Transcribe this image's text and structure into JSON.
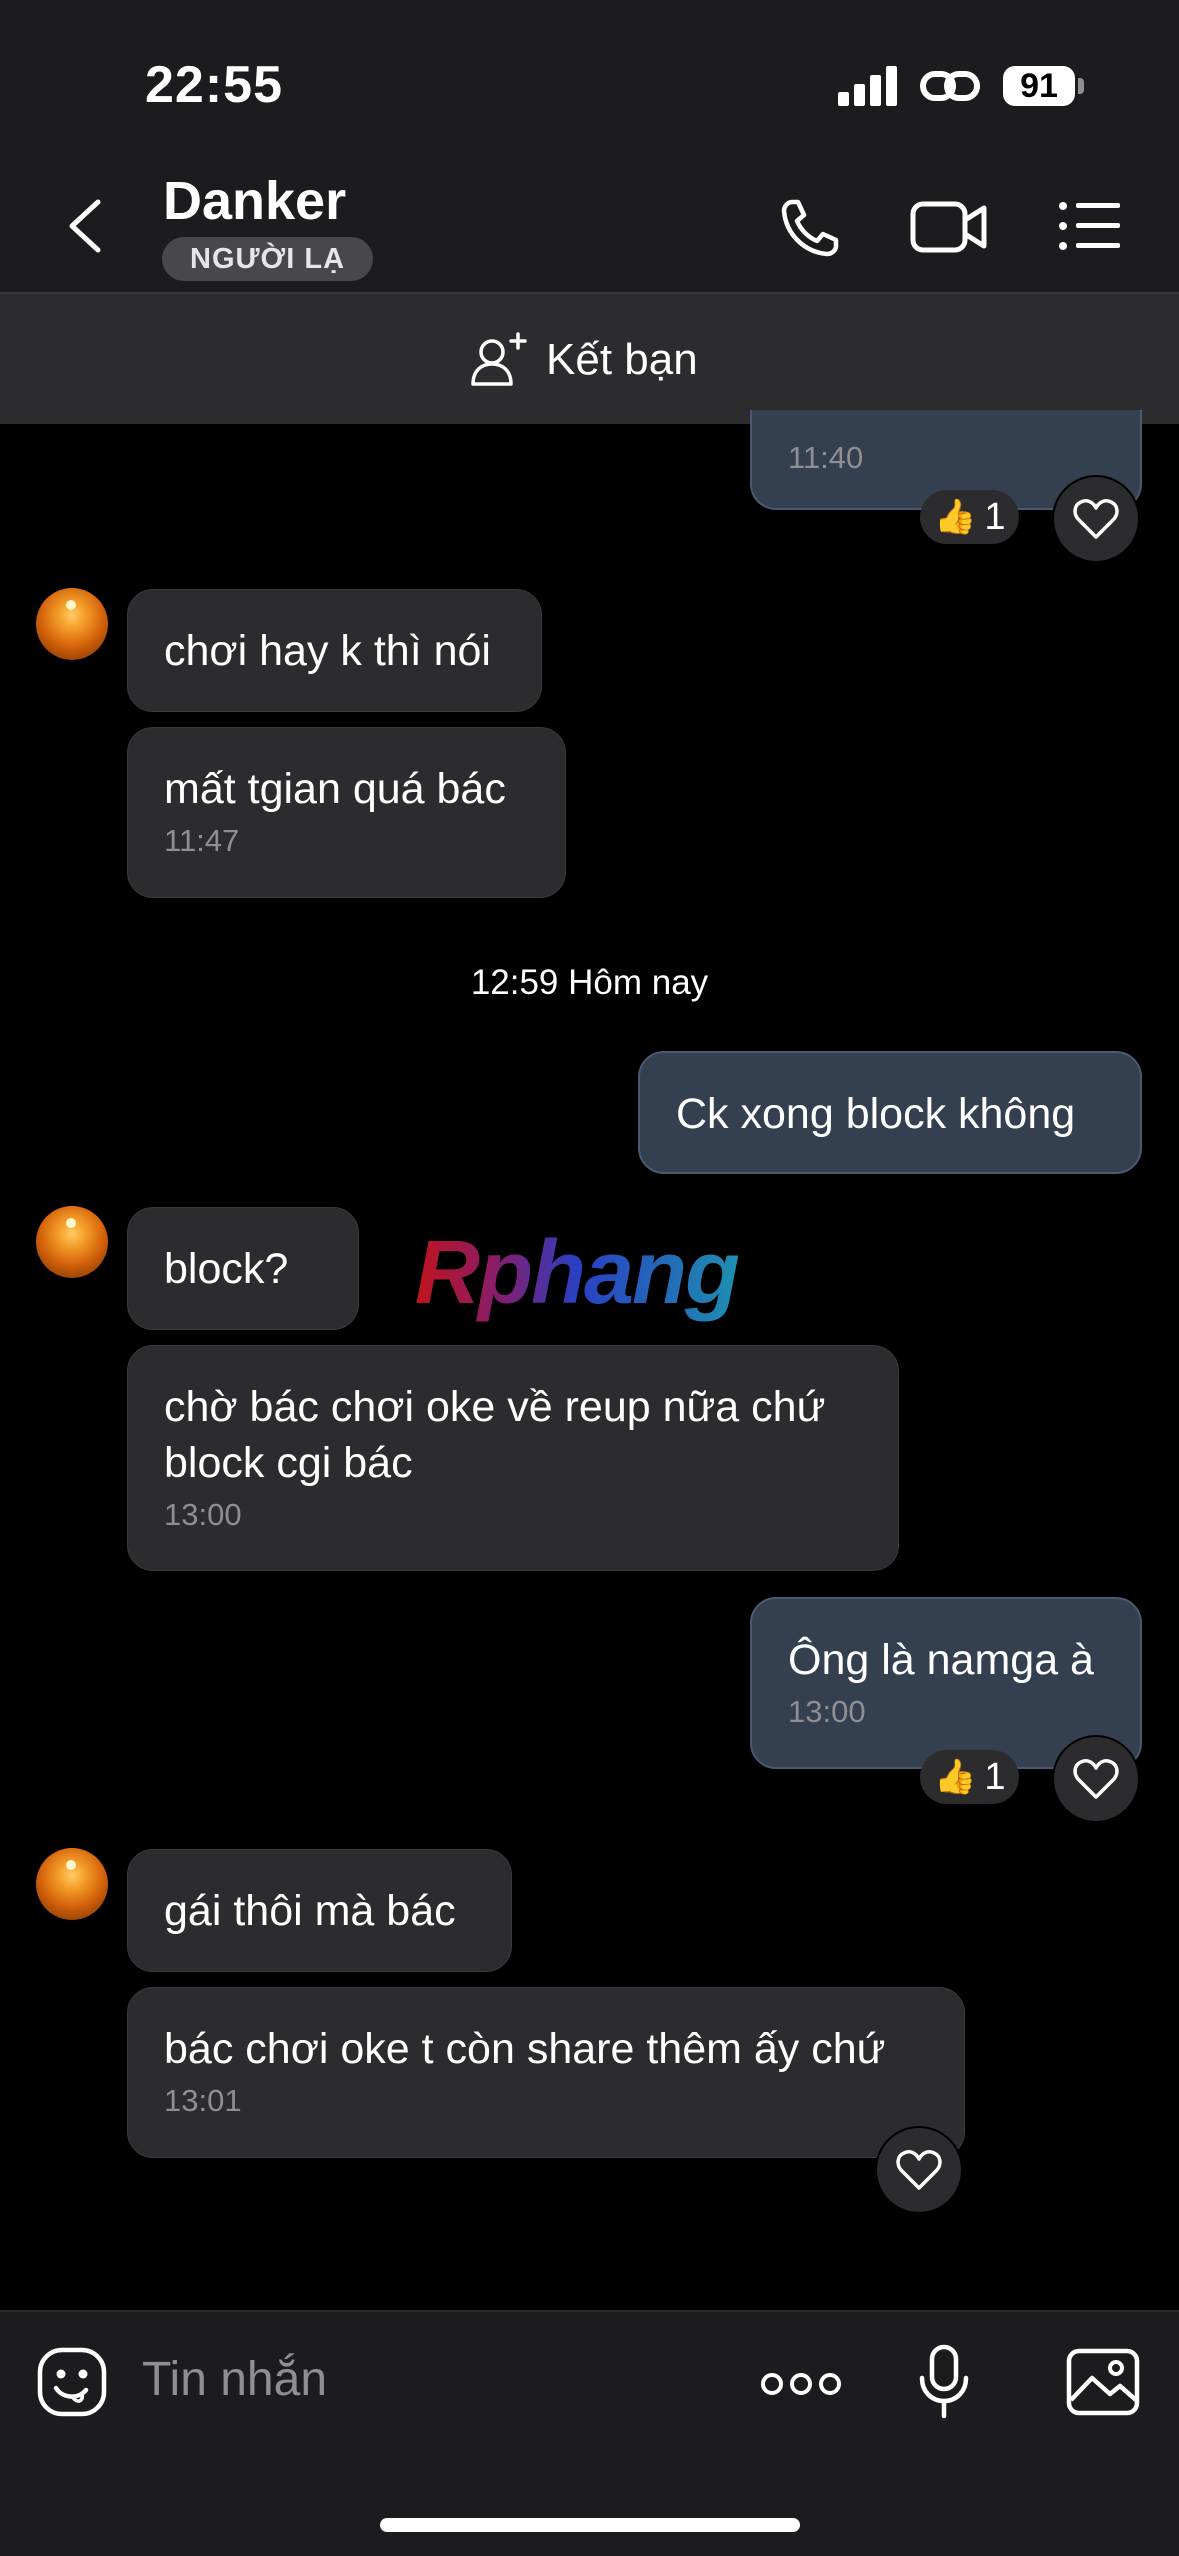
{
  "status_bar": {
    "time": "22:55",
    "battery": "91"
  },
  "header": {
    "contact_name": "Danker",
    "badge": "NGƯỜI LẠ"
  },
  "friend_bar": {
    "label": "Kết bạn"
  },
  "messages": {
    "m0": {
      "time": "11:40",
      "reaction_count": "1"
    },
    "m1": {
      "text": "chơi hay k thì nói"
    },
    "m2": {
      "text": "mất tgian quá bác",
      "time": "11:47"
    },
    "separator": "12:59 Hôm nay",
    "m3": {
      "text": "Ck xong block không"
    },
    "m4": {
      "text": "block?"
    },
    "m5": {
      "text_line1": "chờ bác chơi oke về reup nữa chứ",
      "text_line2": "block cgi bác",
      "time": "13:00"
    },
    "m6": {
      "text": "Ông là namga à",
      "time": "13:00",
      "reaction_count": "1"
    },
    "m7": {
      "text": "gái thôi mà bác"
    },
    "m8": {
      "text": "bác chơi oke t còn share thêm ấy chứ",
      "time": "13:01"
    }
  },
  "watermark": "Rphang",
  "input": {
    "placeholder": "Tin nhắn"
  },
  "icons": [
    "back-icon",
    "phone-icon",
    "video-call-icon",
    "menu-icon",
    "add-friend-icon",
    "heart-icon",
    "thumbs-up-icon",
    "emoji-icon",
    "more-icon",
    "microphone-icon",
    "image-icon"
  ]
}
